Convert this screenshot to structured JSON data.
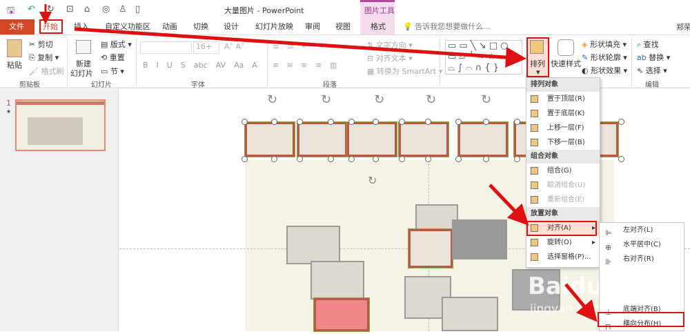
{
  "window": {
    "title": "大量图片 - PowerPoint",
    "context_tab_group": "图片工具",
    "user": "郑荣"
  },
  "tabs": [
    "文件",
    "开始",
    "插入",
    "自定义功能区",
    "动画",
    "切换",
    "设计",
    "幻灯片放映",
    "审阅",
    "视图",
    "格式"
  ],
  "tell_me": "告诉我您想要做什么...",
  "clipboard": {
    "paste": "粘贴",
    "cut": "剪切",
    "copy": "复制",
    "format_painter": "格式刷",
    "label": "剪贴板"
  },
  "slides_group": {
    "new_slide_1": "新建",
    "new_slide_2": "幻灯片",
    "layout": "版式",
    "reset": "重置",
    "section": "节",
    "label": "幻灯片"
  },
  "font_group": {
    "size": "16+",
    "label": "字体",
    "buttons": [
      "B",
      "I",
      "U",
      "S",
      "abc",
      "AV",
      "Aa",
      "A"
    ]
  },
  "paragraph_group": {
    "text_direction": "文字方向",
    "align_text": "对齐文本",
    "smartart": "转换为 SmartArt",
    "label": "段落"
  },
  "drawing_group": {
    "arrange": "排列",
    "quick_styles": "快速样式",
    "shape_fill": "形状填充",
    "shape_outline": "形状轮廓",
    "shape_effects": "形状效果"
  },
  "editing_group": {
    "find": "查找",
    "replace": "替换",
    "select": "选择",
    "label": "编辑"
  },
  "thumbnail": {
    "number": "1",
    "star": "★"
  },
  "arrange_menu": {
    "sections": [
      {
        "header": "排列对象",
        "items": [
          {
            "label": "置于顶层(R)",
            "enabled": true
          },
          {
            "label": "置于底层(K)",
            "enabled": true
          },
          {
            "label": "上移一层(F)",
            "enabled": true
          },
          {
            "label": "下移一层(B)",
            "enabled": true
          }
        ]
      },
      {
        "header": "组合对象",
        "items": [
          {
            "label": "组合(G)",
            "enabled": true
          },
          {
            "label": "取消组合(U)",
            "enabled": false
          },
          {
            "label": "重新组合(E)",
            "enabled": false
          }
        ]
      },
      {
        "header": "放置对象",
        "items": [
          {
            "label": "对齐(A)",
            "enabled": true
          },
          {
            "label": "旋转(O)",
            "enabled": true
          },
          {
            "label": "选择窗格(P)...",
            "enabled": true
          }
        ]
      }
    ]
  },
  "align_submenu": [
    "左对齐(L)",
    "水平居中(C)",
    "右对齐(R)",
    "底端对齐(B)",
    "横向分布(H)"
  ],
  "watermark": {
    "text": "Baidu",
    "url": "jingyan.baidu.com"
  },
  "colors": {
    "file_tab": "#d24726",
    "highlight": "#d11111",
    "context_tab": "#f5dcec",
    "slide_bg": "#f5f2e6"
  }
}
